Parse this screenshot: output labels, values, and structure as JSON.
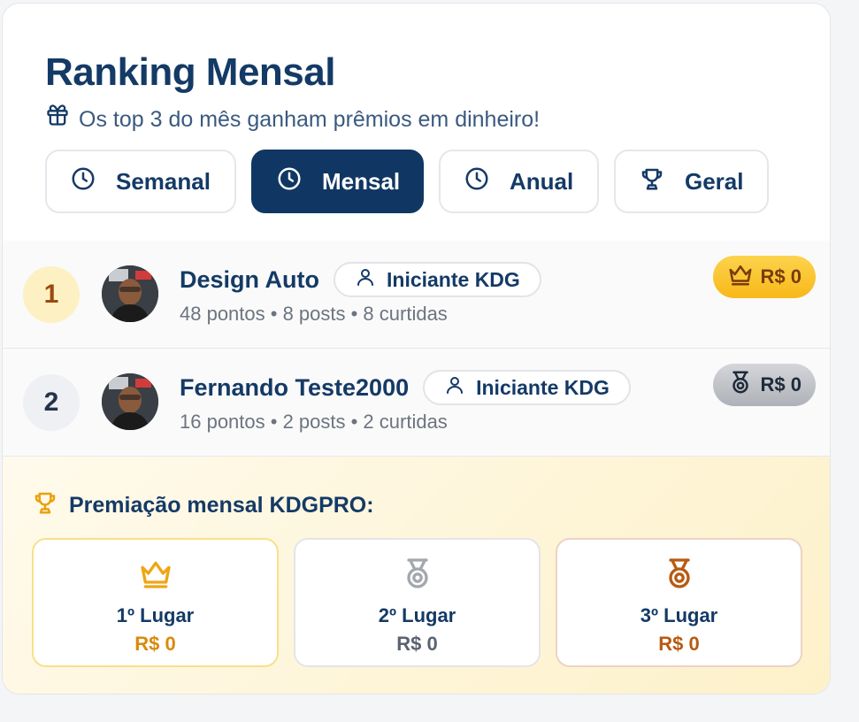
{
  "header": {
    "title": "Ranking Mensal",
    "subtitle": "Os top 3 do mês ganham prêmios em dinheiro!"
  },
  "tabs": [
    {
      "label": "Semanal",
      "icon": "clock-icon",
      "active": false
    },
    {
      "label": "Mensal",
      "icon": "clock-icon",
      "active": true
    },
    {
      "label": "Anual",
      "icon": "clock-icon",
      "active": false
    },
    {
      "label": "Geral",
      "icon": "trophy-icon",
      "active": false
    }
  ],
  "ranking": [
    {
      "position": "1",
      "name": "Design Auto",
      "level": "Iniciante KDG",
      "stats": "48 pontos • 8 posts • 8 curtidas",
      "prize": "R$ 0",
      "prize_icon": "crown-icon"
    },
    {
      "position": "2",
      "name": "Fernando Teste2000",
      "level": "Iniciante KDG",
      "stats": "16 pontos • 2 posts • 2 curtidas",
      "prize": "R$ 0",
      "prize_icon": "medal-icon"
    }
  ],
  "awards": {
    "title": "Premiação mensal KDGPRO:",
    "items": [
      {
        "place": "1º Lugar",
        "value": "R$ 0",
        "icon": "crown-icon"
      },
      {
        "place": "2º Lugar",
        "value": "R$ 0",
        "icon": "medal-icon"
      },
      {
        "place": "3º Lugar",
        "value": "R$ 0",
        "icon": "medal-icon"
      }
    ]
  },
  "colors": {
    "primary": "#103763",
    "gold": "#f8b818",
    "silver": "#aeb1b7",
    "bronze": "#b85a12"
  }
}
